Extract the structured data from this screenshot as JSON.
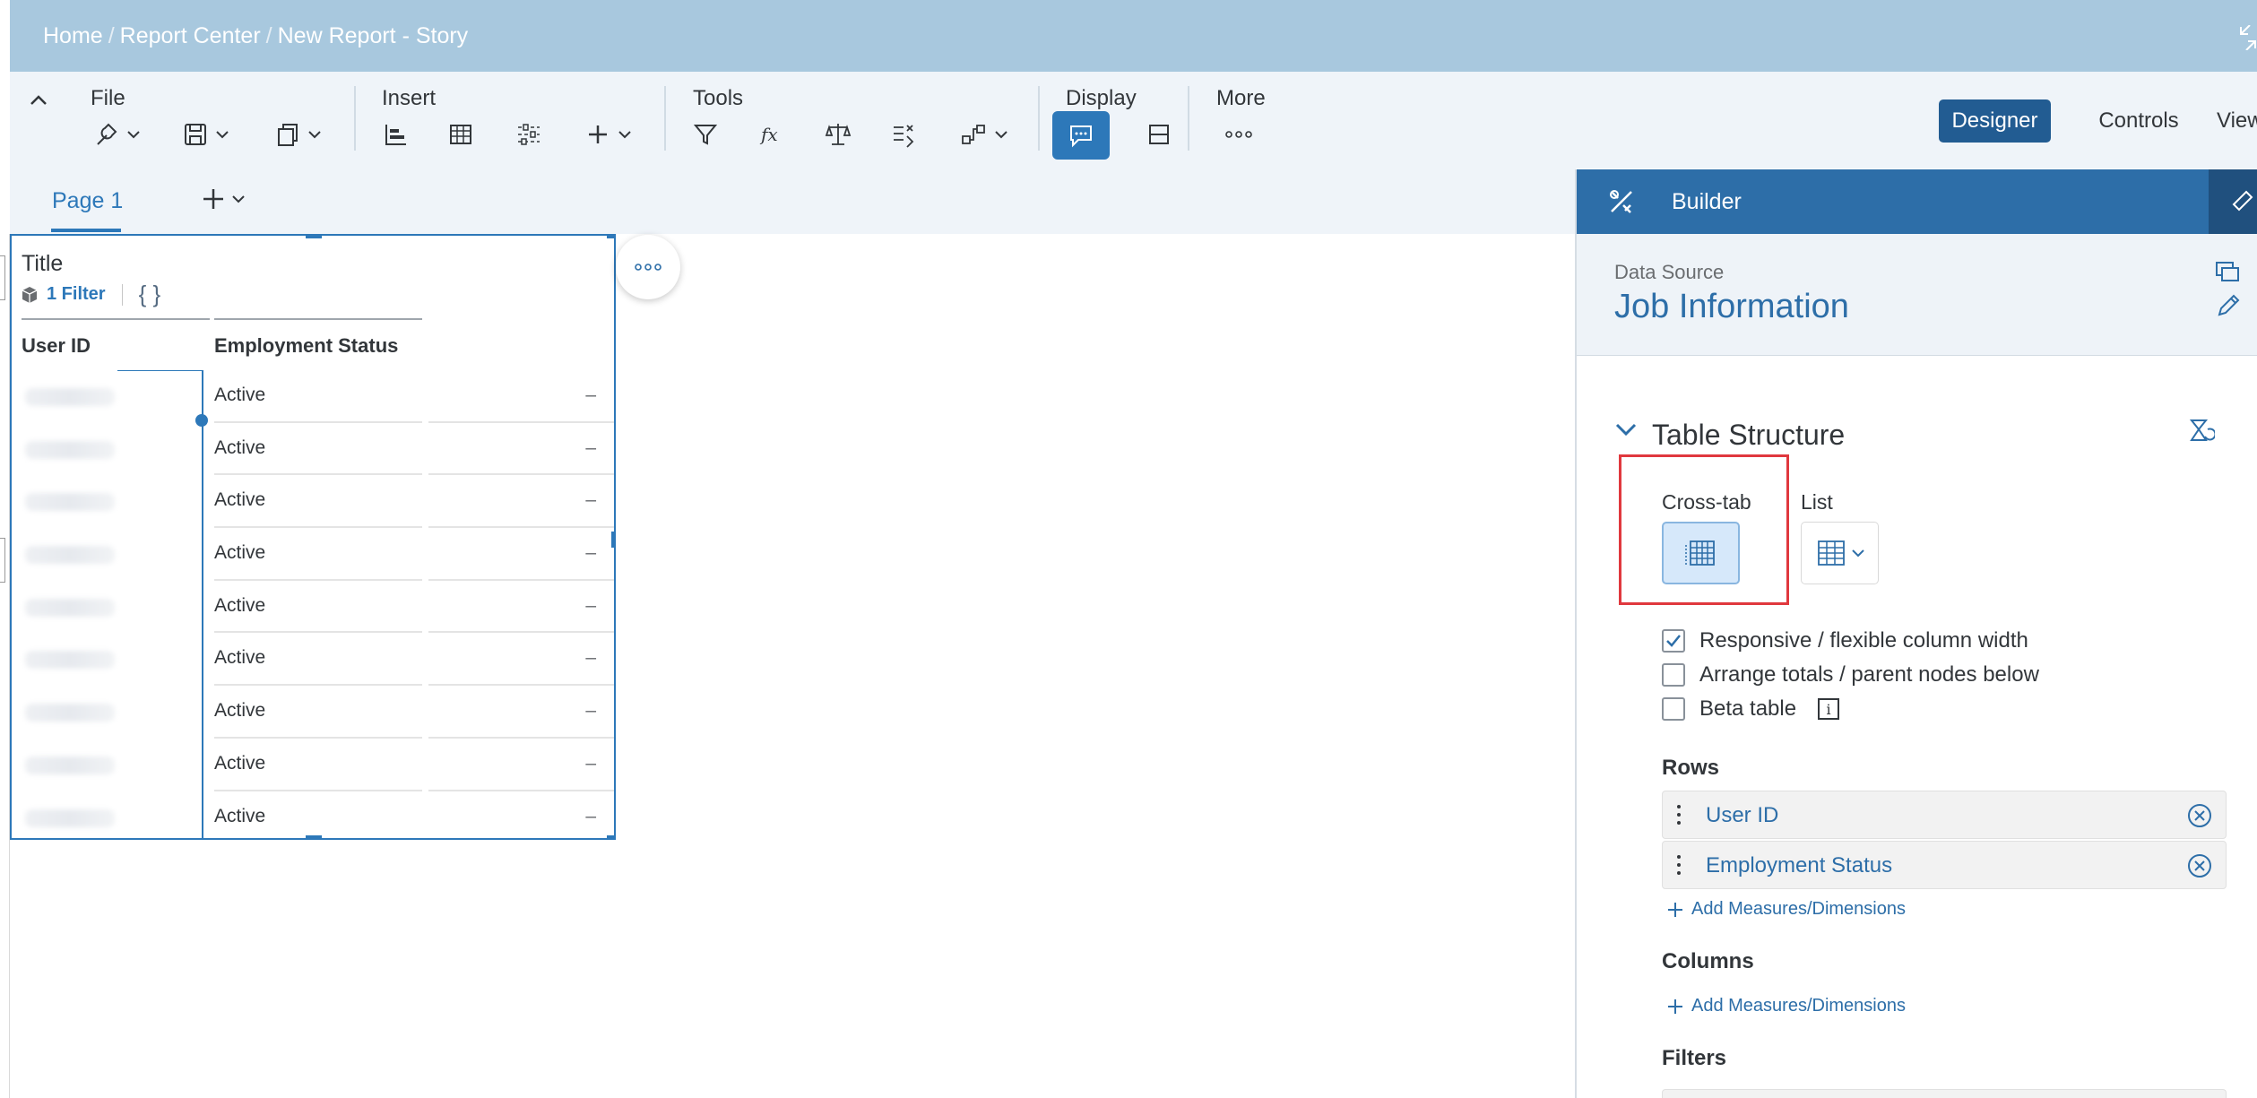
{
  "breadcrumb": {
    "home": "Home",
    "report_center": "Report Center",
    "current": "New Report - Story",
    "separator": "/"
  },
  "toolbar": {
    "groups": {
      "file": "File",
      "insert": "Insert",
      "tools": "Tools",
      "display": "Display",
      "more": "More"
    },
    "modes": {
      "designer": "Designer",
      "controls": "Controls",
      "view": "View"
    }
  },
  "pages": {
    "active_tab": "Page 1"
  },
  "widget": {
    "title": "Title",
    "filter_label": "1 Filter",
    "braces": "{ }",
    "columns": [
      "User ID",
      "Employment Status"
    ],
    "rows": [
      {
        "status": "Active",
        "value": "–"
      },
      {
        "status": "Active",
        "value": "–"
      },
      {
        "status": "Active",
        "value": "–"
      },
      {
        "status": "Active",
        "value": "–"
      },
      {
        "status": "Active",
        "value": "–"
      },
      {
        "status": "Active",
        "value": "–"
      },
      {
        "status": "Active",
        "value": "–"
      },
      {
        "status": "Active",
        "value": "–"
      },
      {
        "status": "Active",
        "value": "–"
      }
    ]
  },
  "builder": {
    "title": "Builder",
    "data_source_label": "Data Source",
    "data_source_name": "Job Information",
    "table_structure": "Table Structure",
    "crosstab_label": "Cross-tab",
    "list_label": "List",
    "options": [
      {
        "label": "Responsive / flexible column width",
        "checked": true
      },
      {
        "label": "Arrange totals / parent nodes below",
        "checked": false
      },
      {
        "label": "Beta table",
        "checked": false
      }
    ],
    "rows_heading": "Rows",
    "row_tokens": [
      "User ID",
      "Employment Status"
    ],
    "add_measures": "Add Measures/Dimensions",
    "columns_heading": "Columns",
    "filters_heading": "Filters"
  },
  "colors": {
    "accent": "#2d78b9",
    "header_bg": "#a8c8de",
    "toolbar_bg": "#eff4f9",
    "designer_btn": "#225c92",
    "highlight": "#e0383e"
  }
}
